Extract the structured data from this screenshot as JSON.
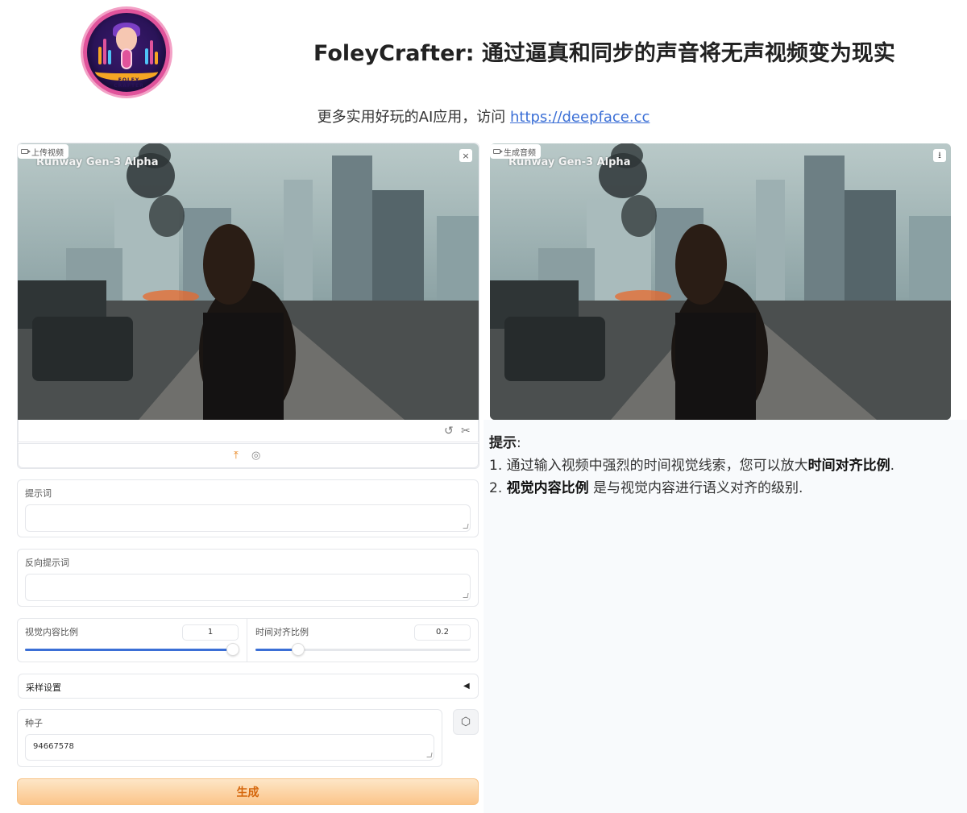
{
  "header": {
    "title": "FoleyCrafter: 通过逼真和同步的声音将无声视频变为现实",
    "subtitle_prefix": "更多实用好玩的AI应用，访问 ",
    "subtitle_link": "https://deepface.cc",
    "logo_text": "FOLEY CRAFTER"
  },
  "upload_video": {
    "label": "上传视频",
    "watermark": "Runway Gen-3 Alpha",
    "close_icon": "×"
  },
  "generated_video": {
    "label": "生成音频",
    "watermark": "Runway Gen-3 Alpha",
    "download_icon": "⭳"
  },
  "icons": {
    "undo": "↺",
    "scissors": "✂",
    "upload": "⤒",
    "webcam": "◎",
    "dice": "⬡"
  },
  "prompt": {
    "label": "提示词",
    "value": ""
  },
  "negative_prompt": {
    "label": "反向提示词",
    "value": ""
  },
  "sliders": {
    "visual_content_ratio": {
      "label": "视觉内容比例",
      "value": "1",
      "fraction": 1.0
    },
    "temporal_align_ratio": {
      "label": "时间对齐比例",
      "value": "0.2",
      "fraction": 0.2
    }
  },
  "sampling": {
    "label": "采样设置",
    "arrow": "◀"
  },
  "seed": {
    "label": "种子",
    "value": "94667578"
  },
  "generate_button": "生成",
  "tips": {
    "title": "提示",
    "colon": ":",
    "item1_prefix": "1.  通过输入视频中强烈的时间视觉线索，您可以放大",
    "item1_bold": "时间对齐比例",
    "item1_suffix": ".",
    "item2_prefix": "2.  ",
    "item2_bold": "视觉内容比例",
    "item2_suffix": "  是与视觉内容进行语义对齐的级别."
  },
  "colors": {
    "accent": "#3b6fd6",
    "generate_text": "#d5670d",
    "generate_bg": "#fbc58a"
  }
}
